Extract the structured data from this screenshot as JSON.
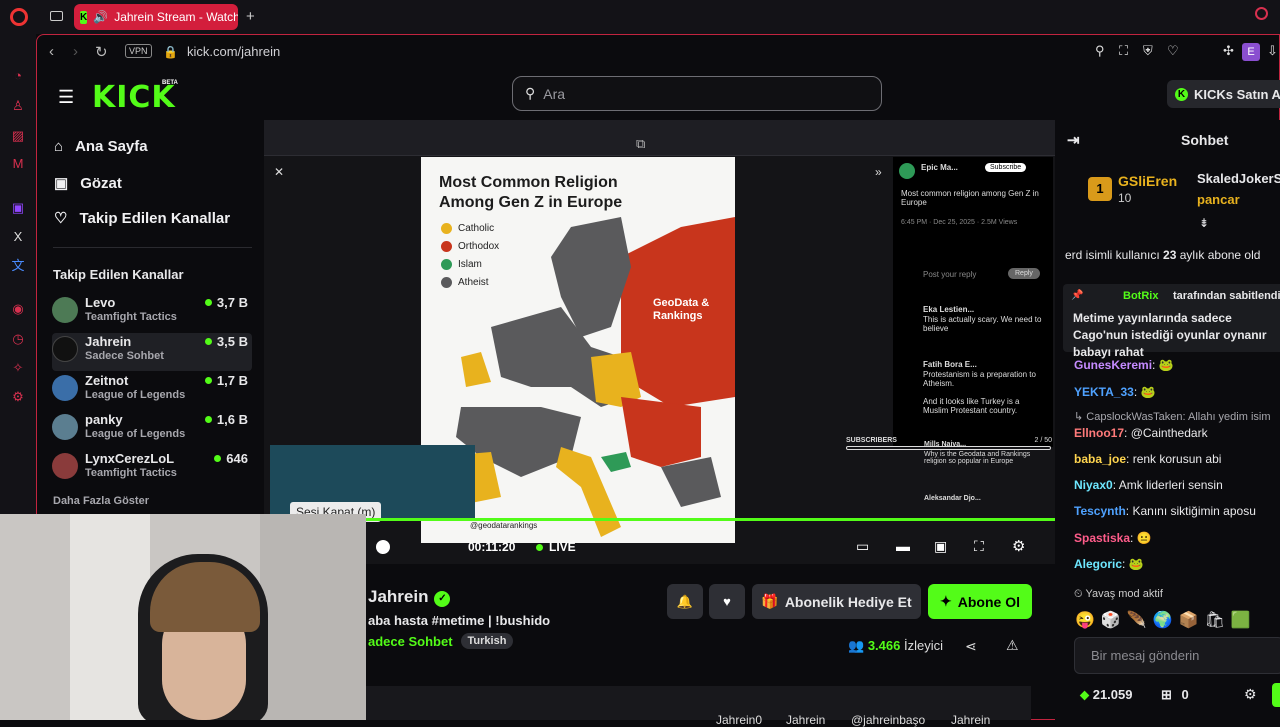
{
  "browser": {
    "tab_title": "Jahrein Stream - Watch",
    "url": "kick.com/jahrein",
    "vpn": "VPN",
    "profile_initial": "E"
  },
  "header": {
    "logo": "KICK",
    "beta": "BETA",
    "search_placeholder": "Ara",
    "kicks_button": "KICKs Satın Al"
  },
  "sidebar": {
    "nav": [
      {
        "label": "Ana Sayfa",
        "icon": "home-icon"
      },
      {
        "label": "Gözat",
        "icon": "browse-icon"
      },
      {
        "label": "Takip Edilen Kanallar",
        "icon": "heart-icon"
      }
    ],
    "followed_title": "Takip Edilen Kanallar",
    "channels": [
      {
        "name": "Levo",
        "category": "Teamfight Tactics",
        "viewers": "3,7 B"
      },
      {
        "name": "Jahrein",
        "category": "Sadece Sohbet",
        "viewers": "3,5 B"
      },
      {
        "name": "Zeitnot",
        "category": "League of Legends",
        "viewers": "1,7 B"
      },
      {
        "name": "panky",
        "category": "League of Legends",
        "viewers": "1,6 B"
      },
      {
        "name": "LynxCerezLoL",
        "category": "Teamfight Tactics",
        "viewers": "646"
      }
    ],
    "show_more": "Daha Fazla Göster"
  },
  "video": {
    "map_title": "Most Common Religion Among Gen Z in Europe",
    "legend": [
      {
        "label": "Catholic",
        "color": "#e8b21e"
      },
      {
        "label": "Orthodox",
        "color": "#c8351c"
      },
      {
        "label": "Islam",
        "color": "#2e9a57"
      },
      {
        "label": "Atheist",
        "color": "#5a5a5c"
      }
    ],
    "watermark": "GeoData & Rankings",
    "handle": "@geodatarankings",
    "tweet": {
      "author": "Epic Ma...",
      "subscribe": "Subscribe",
      "text": "Most common religion among Gen Z in Europe",
      "time": "6:45 PM · Dec 25, 2025 · 2.5M Views",
      "reply_placeholder": "Post your reply",
      "reply_button": "Reply",
      "replies": [
        {
          "author": "Eka Lestien...",
          "text": "This is actually scary. We need to believe"
        },
        {
          "author": "Fatih Bora E...",
          "text": "Protestanism is a preparation to Atheism.\n\nAnd it looks like Turkey is a Muslim Protestant country."
        },
        {
          "author": "Mills Naiva...",
          "text": "Why is the Geodata and Rankings religion so popular in Europe"
        },
        {
          "author": "Aleksandar Djo...",
          "text": ""
        }
      ]
    },
    "subscribers_label": "SUBSCRIBERS",
    "subscribers_count": "2 / 50",
    "tooltip": "Sesi Kapat (m)",
    "time": "00:11:20",
    "live": "LIVE"
  },
  "stream": {
    "streamer": "Jahrein",
    "title": "aba hasta #metime | !bushido",
    "category": "adece Sohbet",
    "language": "Turkish",
    "gift_button": "Abonelik Hediye Et",
    "subscribe_button": "Abone Ol",
    "viewers": "3.466",
    "viewers_label": "İzleyici",
    "socials": [
      "Jahrein0",
      "Jahrein",
      "@jahreinbaşo",
      "Jahrein"
    ]
  },
  "chat": {
    "title": "Sohbet",
    "top_gifters": [
      {
        "rank": "1",
        "name": "GSliEren",
        "count": "10"
      },
      {
        "name": "SkaledJokerS"
      },
      {
        "name": "pancar"
      }
    ],
    "sub_notice_pre": "erd isimli kullanıcı ",
    "sub_notice_num": "23",
    "sub_notice_post": " aylık abone old",
    "pinned_by": "BotRix",
    "pinned_label": "tarafından sabitlendi",
    "pinned_text": "Metime yayınlarında sadece Cago'nun istediği oyunlar oynanır babayı rahat",
    "messages": [
      {
        "user": "GunesKeremi",
        "text": "",
        "color": "#c58bff"
      },
      {
        "user": "YEKTA_33",
        "text": "",
        "color": "#4fa2ff"
      },
      {
        "user": "CapslockWasTaken",
        "text": "Allahı yedim isim",
        "color": "#a7a7ad",
        "reply": true
      },
      {
        "user": "Ellnoo17",
        "text": "@Cainthedark",
        "color": "#ff7a7a"
      },
      {
        "user": "baba_joe",
        "text": "renk korusun abi",
        "color": "#ffd54f"
      },
      {
        "user": "Niyax0",
        "text": "Amk liderleri sensin",
        "color": "#6ee7ff"
      },
      {
        "user": "Tescynth",
        "text": "Kanını siktiğimin aposu",
        "color": "#4fa2ff"
      },
      {
        "user": "Spastiska",
        "text": "",
        "color": "#ff5c8a"
      },
      {
        "user": "Alegoric",
        "text": "",
        "color": "#6ee7ff"
      }
    ],
    "slow_mode": "Yavaş mod aktif",
    "input_placeholder": "Bir mesaj gönderin",
    "points": "21.059",
    "gift_count": "0"
  }
}
